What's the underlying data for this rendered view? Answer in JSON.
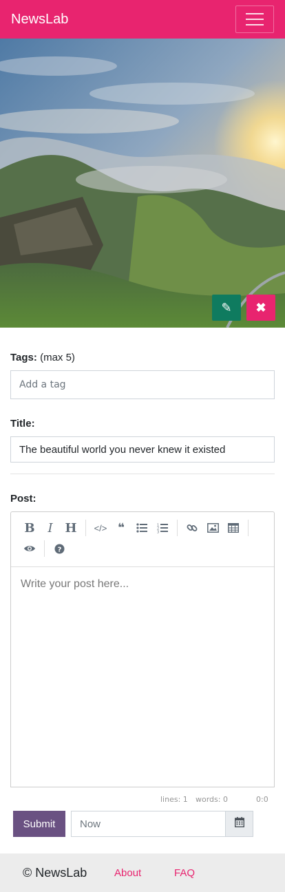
{
  "navbar": {
    "brand": "NewsLab",
    "menu_icon": "hamburger-icon"
  },
  "hero": {
    "edit_icon": "pencil-icon",
    "remove_icon": "close-icon"
  },
  "tags": {
    "label": "Tags:",
    "hint": "(max 5)",
    "placeholder": "Add a tag"
  },
  "title_field": {
    "label": "Title:",
    "value": "The beautiful world you never knew it existed"
  },
  "post": {
    "label": "Post:",
    "placeholder": "Write your post here...",
    "toolbar": [
      "bold-icon",
      "italic-icon",
      "heading-icon",
      "code-icon",
      "quote-icon",
      "unordered-list-icon",
      "ordered-list-icon",
      "link-icon",
      "image-icon",
      "table-icon",
      "preview-icon",
      "help-icon"
    ],
    "status": {
      "lines_label": "lines: 1",
      "words_label": "words: 0",
      "cursor": "0:0"
    }
  },
  "actions": {
    "submit_label": "Submit",
    "date_value": "Now",
    "calendar_icon": "calendar-icon"
  },
  "footer": {
    "copyright": "© NewsLab",
    "about": "About",
    "faq": "FAQ"
  },
  "colors": {
    "brand": "#e8246f",
    "edit": "#0f7b5f",
    "submit": "#6a5182"
  }
}
